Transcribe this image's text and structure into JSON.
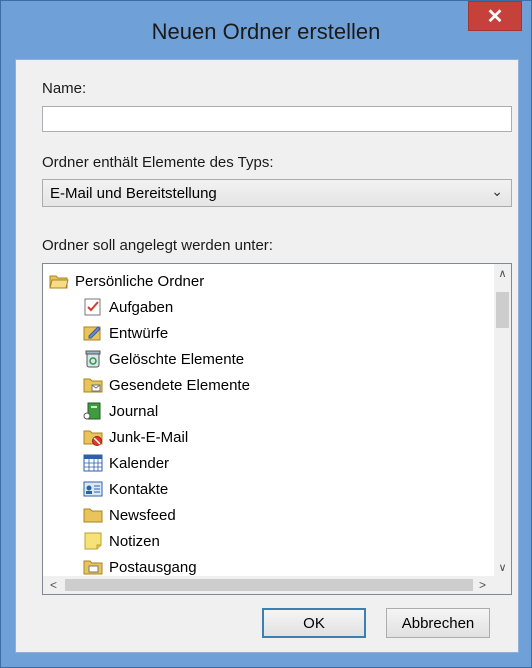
{
  "window": {
    "title": "Neuen Ordner erstellen",
    "close_glyph": "✕"
  },
  "name_field": {
    "label": "Name:",
    "value": ""
  },
  "type_field": {
    "label": "Ordner enthält Elemente des Typs:",
    "value": "E-Mail und Bereitstellung",
    "chevron": "⌄"
  },
  "tree": {
    "label": "Ordner soll angelegt werden unter:",
    "root": {
      "label": "Persönliche Ordner",
      "icon": "folder-open-icon"
    },
    "items": [
      {
        "label": "Aufgaben",
        "icon": "tasks-icon"
      },
      {
        "label": "Entwürfe",
        "icon": "drafts-icon"
      },
      {
        "label": "Gelöschte Elemente",
        "icon": "recycle-bin-icon"
      },
      {
        "label": "Gesendete Elemente",
        "icon": "sent-items-icon"
      },
      {
        "label": "Journal",
        "icon": "journal-icon"
      },
      {
        "label": "Junk-E-Mail",
        "icon": "junk-mail-icon"
      },
      {
        "label": "Kalender",
        "icon": "calendar-icon"
      },
      {
        "label": "Kontakte",
        "icon": "contacts-icon"
      },
      {
        "label": "Newsfeed",
        "icon": "folder-icon"
      },
      {
        "label": "Notizen",
        "icon": "notes-icon"
      },
      {
        "label": "Postausgang",
        "icon": "outbox-icon"
      }
    ],
    "scroll_up": "∧",
    "scroll_down": "∨",
    "scroll_left": "<",
    "scroll_right": ">"
  },
  "buttons": {
    "ok": "OK",
    "cancel": "Abbrechen"
  },
  "colors": {
    "frame": "#6fa1d8",
    "close": "#c7413b",
    "selection_border": "#3c7fb1"
  }
}
